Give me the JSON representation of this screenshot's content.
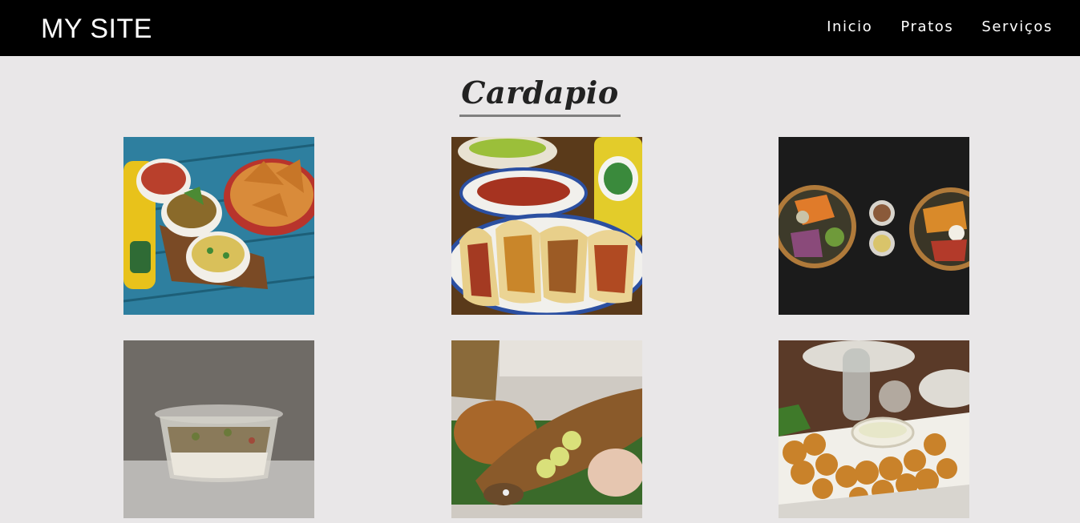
{
  "header": {
    "logo": "MY SITE",
    "nav": [
      {
        "label": "Inicio"
      },
      {
        "label": "Pratos"
      },
      {
        "label": "Serviços"
      }
    ]
  },
  "main": {
    "title": "Cardapio",
    "dishes": [
      {
        "image": "chips-salsa-jarritos"
      },
      {
        "image": "tacos-plate"
      },
      {
        "image": "poke-bowls-dark-table"
      },
      {
        "image": "rice-salad-container"
      },
      {
        "image": "fried-fish-platter"
      },
      {
        "image": "fried-shrimp-plate"
      }
    ]
  },
  "colors": {
    "header_bg": "#000000",
    "page_bg": "#e9e7e8",
    "title_text": "#222222",
    "title_underline": "#7f7f7f"
  }
}
